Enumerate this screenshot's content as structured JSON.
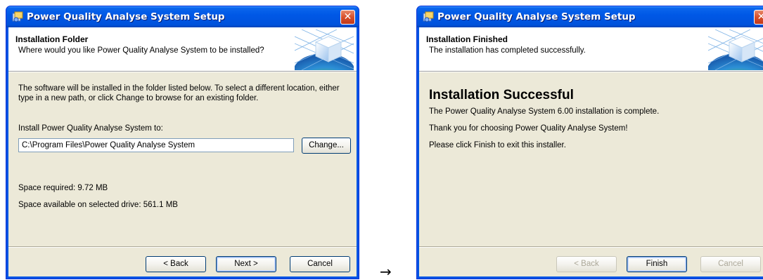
{
  "left_window": {
    "title": "Power Quality Analyse System Setup",
    "header_title": "Installation Folder",
    "header_subtitle": "Where would you like Power Quality Analyse System to be installed?",
    "description": "The software will be installed in the folder listed below. To select a different location, either type in a new path, or click Change to browse for an existing folder.",
    "install_label": "Install Power Quality Analyse System to:",
    "install_path": "C:\\Program Files\\Power Quality Analyse System",
    "change_button": "Change...",
    "space_required": "Space required: 9.72 MB",
    "space_available": "Space available on selected drive: 561.1 MB",
    "back_button": "< Back",
    "next_button": "Next >",
    "cancel_button": "Cancel"
  },
  "arrow": "→",
  "right_window": {
    "title": "Power Quality Analyse System Setup",
    "header_title": "Installation Finished",
    "header_subtitle": "The installation has completed successfully.",
    "heading": "Installation Successful",
    "line1": "The Power Quality Analyse System 6.00 installation is complete.",
    "line2": "Thank you for choosing Power Quality Analyse System!",
    "line3": "Please click Finish to exit this installer.",
    "back_button": "< Back",
    "finish_button": "Finish",
    "cancel_button": "Cancel"
  },
  "colors": {
    "title_bar": "#0058e6",
    "dialog_face": "#ece9d8",
    "close_button": "#d7502b"
  }
}
